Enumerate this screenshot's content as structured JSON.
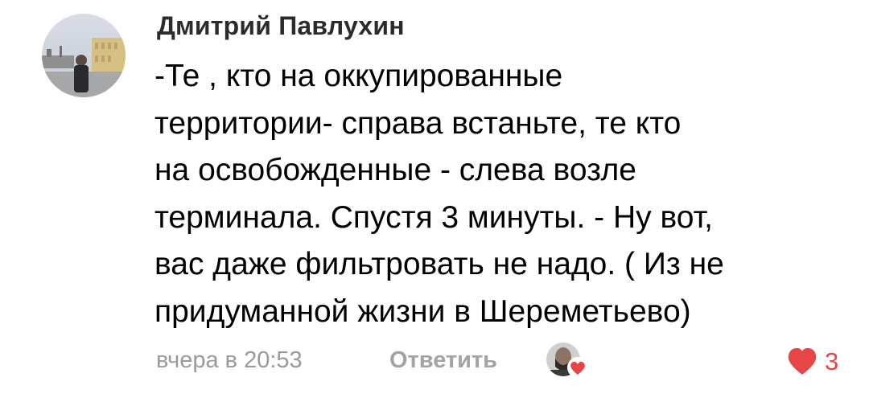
{
  "comment": {
    "author": "Дмитрий Павлухин",
    "text_lines": [
      "-Те , кто на оккупированные",
      "территории- справа встаньте, те кто",
      "на освобожденные - слева возле",
      "терминала. Спустя 3 минуты. - Ну вот,",
      "вас даже фильтровать не надо. ( Из не",
      "придуманной жизни в Шереметьево)"
    ],
    "date": "вчера в 20:53",
    "reply_label": "Ответить",
    "likes_count": "3"
  },
  "icons": {
    "avatar": "user-avatar-photo",
    "liker_avatar": "liker-avatar-photo",
    "liker_heart": "heart-icon",
    "like": "heart-icon"
  },
  "colors": {
    "text": "#000000",
    "author": "#2b2b2b",
    "meta": "#9a9a9a",
    "reply": "#a3a3a3",
    "like_red": "#e64646"
  }
}
